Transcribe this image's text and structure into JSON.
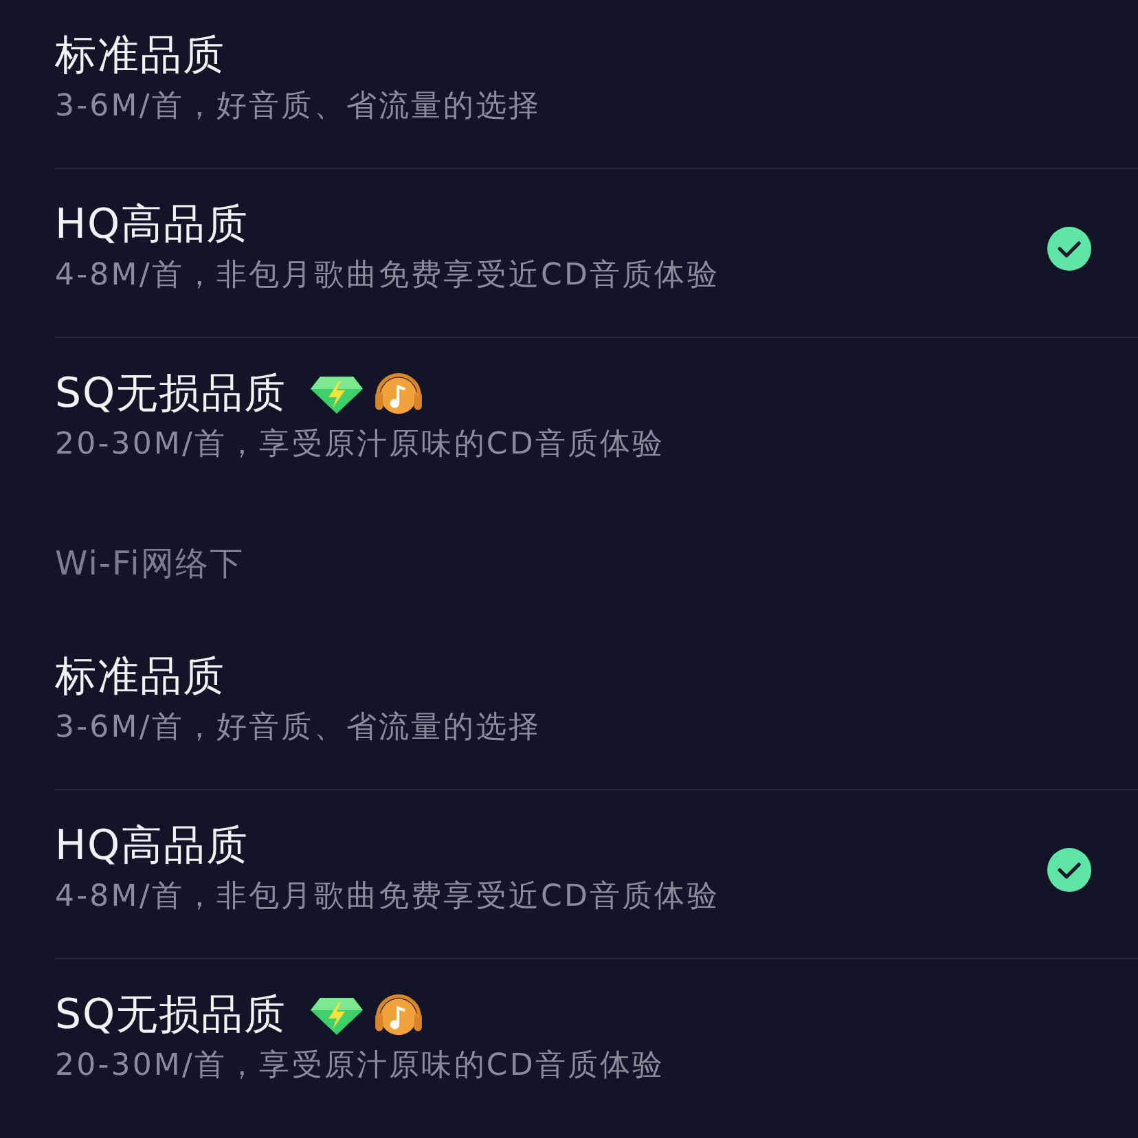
{
  "sections": [
    {
      "options": [
        {
          "title": "标准品质",
          "description": "3-6M/首，好音质、省流量的选择",
          "selected": false,
          "premium": false
        },
        {
          "title": "HQ高品质",
          "description": "4-8M/首，非包月歌曲免费享受近CD音质体验",
          "selected": true,
          "premium": false
        },
        {
          "title": "SQ无损品质",
          "description": "20-30M/首，享受原汁原味的CD音质体验",
          "selected": false,
          "premium": true
        }
      ]
    },
    {
      "header": "Wi-Fi网络下",
      "options": [
        {
          "title": "标准品质",
          "description": "3-6M/首，好音质、省流量的选择",
          "selected": false,
          "premium": false
        },
        {
          "title": "HQ高品质",
          "description": "4-8M/首，非包月歌曲免费享受近CD音质体验",
          "selected": true,
          "premium": false
        },
        {
          "title": "SQ无损品质",
          "description": "20-30M/首，享受原汁原味的CD音质体验",
          "selected": false,
          "premium": true
        }
      ]
    }
  ]
}
